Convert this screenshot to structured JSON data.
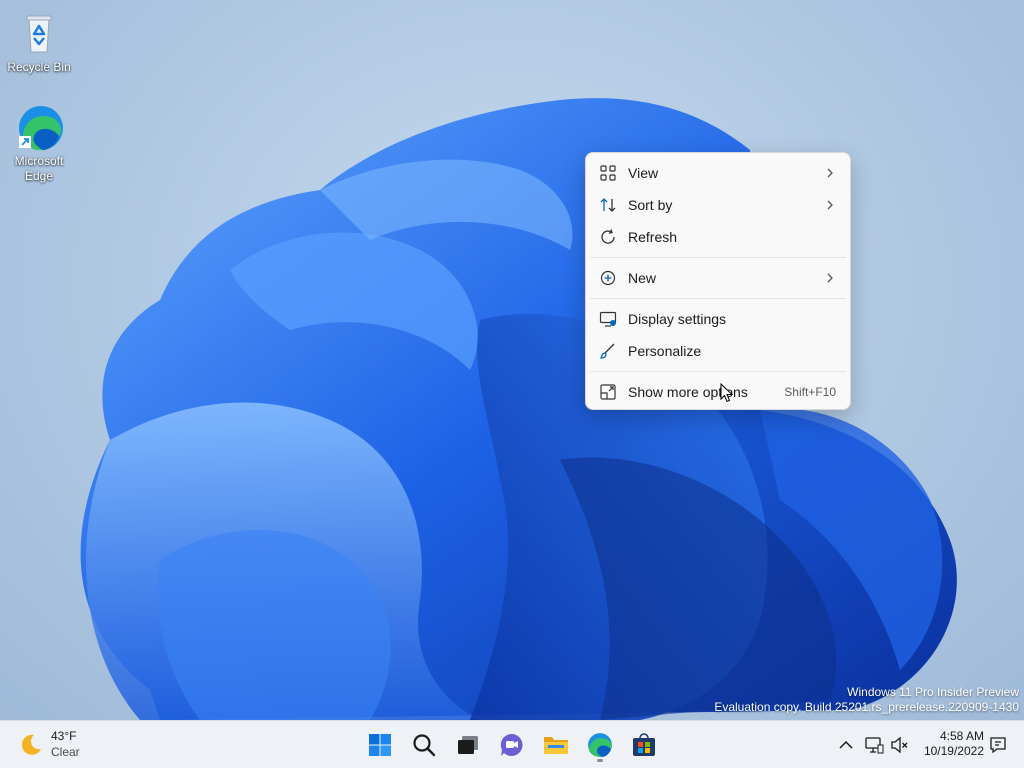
{
  "desktop": {
    "icons": [
      {
        "label": "Recycle Bin",
        "icon": "recycle-bin-icon"
      },
      {
        "label_line1": "Microsoft",
        "label_line2": "Edge",
        "icon": "edge-icon"
      }
    ],
    "watermark": {
      "line1": "Windows 11 Pro Insider Preview",
      "line2": "Evaluation copy. Build 25201.rs_prerelease.220909-1430"
    }
  },
  "context_menu": {
    "items": [
      {
        "label": "View",
        "icon": "view-grid-icon",
        "submenu": true
      },
      {
        "label": "Sort by",
        "icon": "sort-icon",
        "submenu": true
      },
      {
        "label": "Refresh",
        "icon": "refresh-icon"
      },
      {
        "label": "New",
        "icon": "new-plus-icon",
        "submenu": true
      },
      {
        "label": "Display settings",
        "icon": "display-settings-icon"
      },
      {
        "label": "Personalize",
        "icon": "personalize-brush-icon"
      },
      {
        "label": "Show more options",
        "icon": "show-more-icon",
        "shortcut": "Shift+F10"
      }
    ]
  },
  "taskbar": {
    "weather": {
      "temp": "43°F",
      "condition": "Clear",
      "icon": "moon-icon"
    },
    "apps": [
      "start-icon",
      "search-icon",
      "task-view-icon",
      "chat-icon",
      "file-explorer-icon",
      "edge-icon",
      "store-icon"
    ],
    "tray": [
      "chevron-up-icon",
      "network-icon",
      "volume-muted-icon",
      "notification-icon"
    ],
    "clock": {
      "time": "4:58 AM",
      "date": "10/19/2022"
    }
  },
  "colors": {
    "accent": "#0067c0",
    "bloom_dark": "#0a3fb8",
    "bloom_light": "#3d8bff"
  }
}
